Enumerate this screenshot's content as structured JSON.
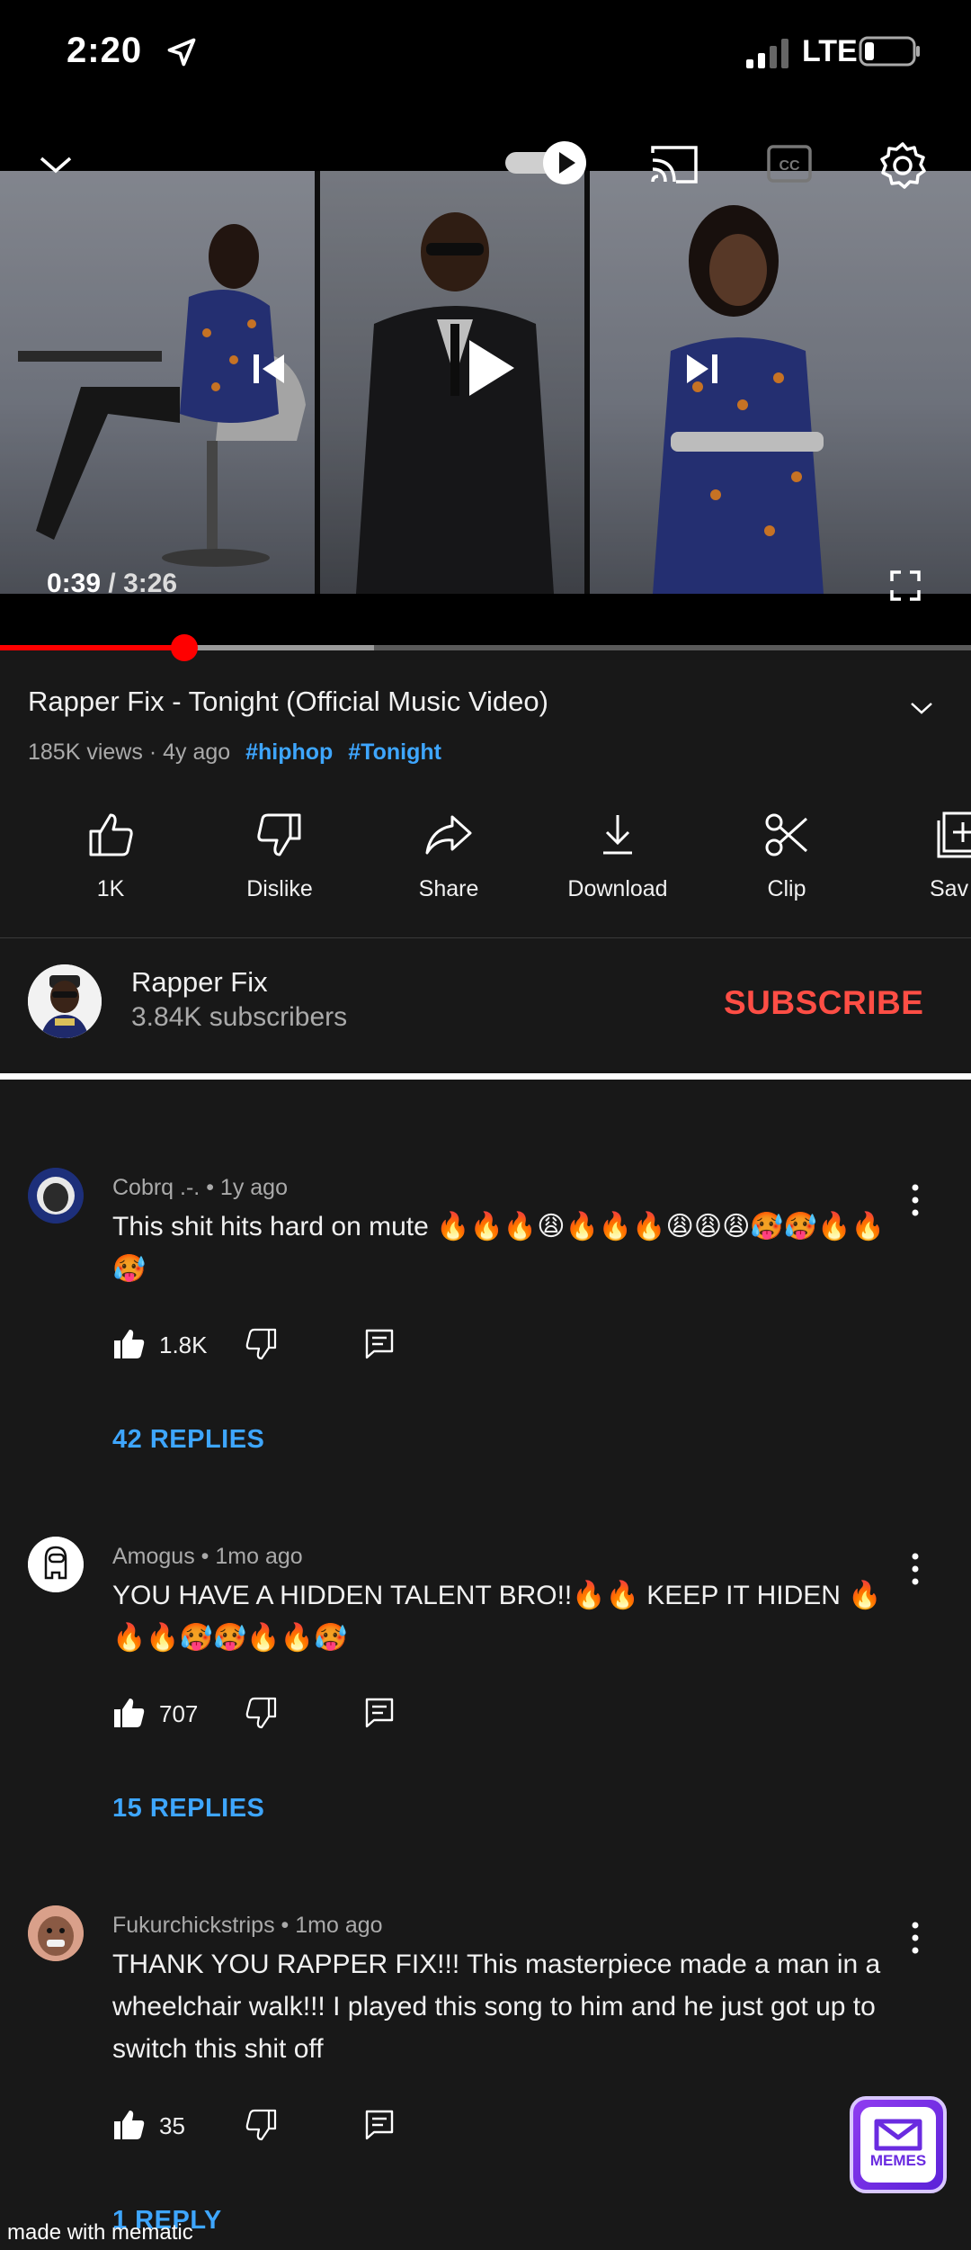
{
  "status_bar": {
    "time": "2:20",
    "network": "LTE"
  },
  "player": {
    "current_time": "0:39",
    "separator": " / ",
    "duration": "3:26",
    "progress": 0.19,
    "buffered": 0.385
  },
  "video": {
    "title": "Rapper Fix  - Tonight (Official Music Video)",
    "views": "185K views",
    "age": "4y ago",
    "tags": [
      "#hiphop",
      "#Tonight"
    ]
  },
  "actions": [
    {
      "id": "like",
      "label": "1K",
      "icon": "thumbs-up-icon"
    },
    {
      "id": "dislike",
      "label": "Dislike",
      "icon": "thumbs-down-icon"
    },
    {
      "id": "share",
      "label": "Share",
      "icon": "share-icon"
    },
    {
      "id": "download",
      "label": "Download",
      "icon": "download-icon"
    },
    {
      "id": "clip",
      "label": "Clip",
      "icon": "scissors-icon"
    },
    {
      "id": "save",
      "label": "Sav",
      "icon": "save-playlist-icon"
    }
  ],
  "channel": {
    "name": "Rapper Fix",
    "subscribers": "3.84K subscribers",
    "subscribe_label": "SUBSCRIBE"
  },
  "comments": [
    {
      "author": "Cobrq .-.",
      "age": "1y ago",
      "text": "This shit hits hard on mute 🔥🔥🔥😩🔥🔥🔥😩😩😩🥵🥵🔥🔥🥵",
      "likes": "1.8K",
      "replies": "42 REPLIES"
    },
    {
      "author": "Amogus",
      "age": "1mo ago",
      "text": "YOU HAVE A HIDDEN TALENT BRO!!🔥🔥 KEEP IT HIDEN 🔥🔥🔥🥵🥵🔥🔥🥵",
      "likes": "707",
      "replies": "15 REPLIES"
    },
    {
      "author": "Fukurchickstrips",
      "age": "1mo ago",
      "text": "THANK YOU RAPPER FIX!!! This masterpiece made a man in a wheelchair walk!!! I played this song to him and he just got up to switch this shit off",
      "likes": "35",
      "replies": "1 REPLY"
    }
  ],
  "watermark": "made with mematic",
  "memes_logo": "MEMES",
  "colors": {
    "accent_red": "#ff0000",
    "subscribe_red": "#ff4e45",
    "link_blue": "#3ea6ff",
    "background": "#181818"
  }
}
